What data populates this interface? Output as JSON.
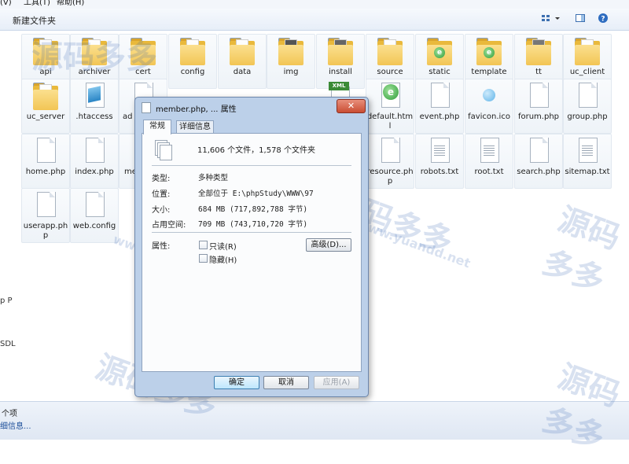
{
  "menubar": {
    "view": "(V)",
    "tools": "工具(T)",
    "help": "帮助(H)"
  },
  "toolbar": {
    "new_folder": "新建文件夹"
  },
  "items": [
    {
      "label": "api",
      "kind": "folder"
    },
    {
      "label": "archiver",
      "kind": "folder"
    },
    {
      "label": "cert",
      "kind": "folder"
    },
    {
      "label": "config",
      "kind": "folder"
    },
    {
      "label": "data",
      "kind": "folder"
    },
    {
      "label": "img",
      "kind": "folder"
    },
    {
      "label": "install",
      "kind": "folder"
    },
    {
      "label": "source",
      "kind": "folder"
    },
    {
      "label": "static",
      "kind": "folder-ie"
    },
    {
      "label": "template",
      "kind": "folder-ie"
    },
    {
      "label": "tt",
      "kind": "folder"
    },
    {
      "label": "uc_client",
      "kind": "folder"
    },
    {
      "label": "uc_server",
      "kind": "folder"
    },
    {
      "label": ".htaccess",
      "kind": "blue"
    },
    {
      "label": "ad",
      "kind": "file"
    },
    {
      "label": "default.html",
      "kind": "ie"
    },
    {
      "label": "event.php",
      "kind": "file"
    },
    {
      "label": "favicon.ico",
      "kind": "bubble"
    },
    {
      "label": "forum.php",
      "kind": "file"
    },
    {
      "label": "group.php",
      "kind": "file"
    },
    {
      "label": "home.php",
      "kind": "file"
    },
    {
      "label": "index.php",
      "kind": "file"
    },
    {
      "label": "me",
      "kind": "file"
    },
    {
      "label": "resource.php",
      "kind": "file"
    },
    {
      "label": "robots.txt",
      "kind": "text"
    },
    {
      "label": "root.txt",
      "kind": "text"
    },
    {
      "label": "search.php",
      "kind": "file"
    },
    {
      "label": "sitemap.txt",
      "kind": "text"
    },
    {
      "label": "userapp.php",
      "kind": "file"
    },
    {
      "label": "web.config",
      "kind": "file"
    },
    {
      "label": "XML",
      "kind": "xml"
    }
  ],
  "left_clip": {
    "a": "p P",
    "b": "SDL"
  },
  "statusbar": {
    "count": "个项",
    "details": "细信息..."
  },
  "dialog": {
    "title": "member.php, ... 属性",
    "close": "✕",
    "tab_general": "常规",
    "tab_details": "详细信息",
    "summary": "11,606 个文件，1,578 个文件夹",
    "type_k": "类型:",
    "type_v": "多种类型",
    "loc_k": "位置:",
    "loc_v": "全部位于 E:\\phpStudy\\WWW\\97",
    "size_k": "大小:",
    "size_v": "684 MB (717,892,788 字节)",
    "disk_k": "占用空间:",
    "disk_v": "709 MB (743,710,720 字节)",
    "attr_k": "属性:",
    "readonly": "只读(R)",
    "hidden": "隐藏(H)",
    "advanced": "高级(D)...",
    "ok": "确定",
    "cancel": "取消",
    "apply": "应用(A)"
  },
  "watermark": {
    "brand": "源码多多",
    "url": "www.yuandd.net"
  }
}
